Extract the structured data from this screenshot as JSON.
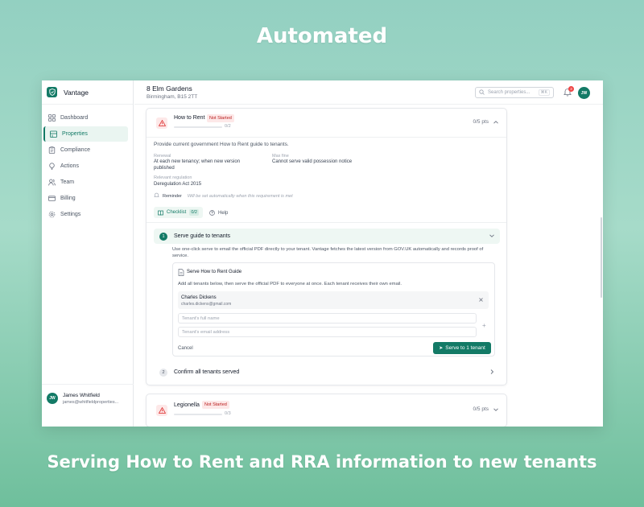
{
  "headline": "Automated",
  "caption": "Serving How to Rent and RRA information to new tenants",
  "app": {
    "name": "Vantage",
    "accent": "#137a66"
  },
  "sidebar": {
    "items": [
      {
        "label": "Dashboard",
        "icon": "dashboard-icon",
        "active": false
      },
      {
        "label": "Properties",
        "icon": "building-icon",
        "active": true
      },
      {
        "label": "Compliance",
        "icon": "clipboard-icon",
        "active": false
      },
      {
        "label": "Actions",
        "icon": "bulb-icon",
        "active": false
      },
      {
        "label": "Team",
        "icon": "users-icon",
        "active": false
      },
      {
        "label": "Billing",
        "icon": "card-icon",
        "active": false
      },
      {
        "label": "Settings",
        "icon": "gear-icon",
        "active": false
      }
    ],
    "user": {
      "initials": "JW",
      "name": "James Whitfield",
      "email": "james@whitfieldproperties..."
    }
  },
  "header": {
    "property_name": "8 Elm Gardens",
    "property_address": "Birmingham, B15 2TT",
    "search_placeholder": "Search properties...",
    "search_shortcut": "⌘K",
    "notification_count": "3",
    "user_initials": "JW"
  },
  "requirements": [
    {
      "title": "How to Rent",
      "status": "Not Started",
      "progress": "0/2",
      "progress_fraction": 0,
      "points": "0/5 pts",
      "expanded": true,
      "description": "Provide current government How to Rent guide to tenants.",
      "renewal_label": "Renewal",
      "renewal_value": "At each new tenancy; when new version published",
      "max_fine_label": "Max fine",
      "max_fine_value": "Cannot serve valid possession notice",
      "regulation_label": "Relevant regulation",
      "regulation_value": "Deregulation Act 2015",
      "reminder_label": "Reminder",
      "reminder_note": "Will be set automatically when this requirement is met",
      "checklist_label": "Checklist",
      "checklist_count": "0/2",
      "help_label": "Help",
      "steps": [
        {
          "number": "1",
          "label": "Serve guide to tenants",
          "description": "Use one-click serve to email the official PDF directly to your tenant. Vantage fetches the latest version from GOV.UK automatically and records proof of service.",
          "serve": {
            "title": "Serve How to Rent Guide",
            "description": "Add all tenants below, then serve the official PDF to everyone at once. Each tenant receives their own email.",
            "tenant_name": "Charles Dickens",
            "tenant_email": "charles.dickens@gmail.com",
            "name_placeholder": "Tenant's full name",
            "email_placeholder": "Tenant's email address",
            "cancel_label": "Cancel",
            "serve_button": "Serve to 1 tenant"
          }
        },
        {
          "number": "2",
          "label": "Confirm all tenants served"
        }
      ]
    },
    {
      "title": "Legionella",
      "status": "Not Started",
      "progress": "0/3",
      "progress_fraction": 0,
      "points": "0/5 pts",
      "expanded": false
    }
  ]
}
